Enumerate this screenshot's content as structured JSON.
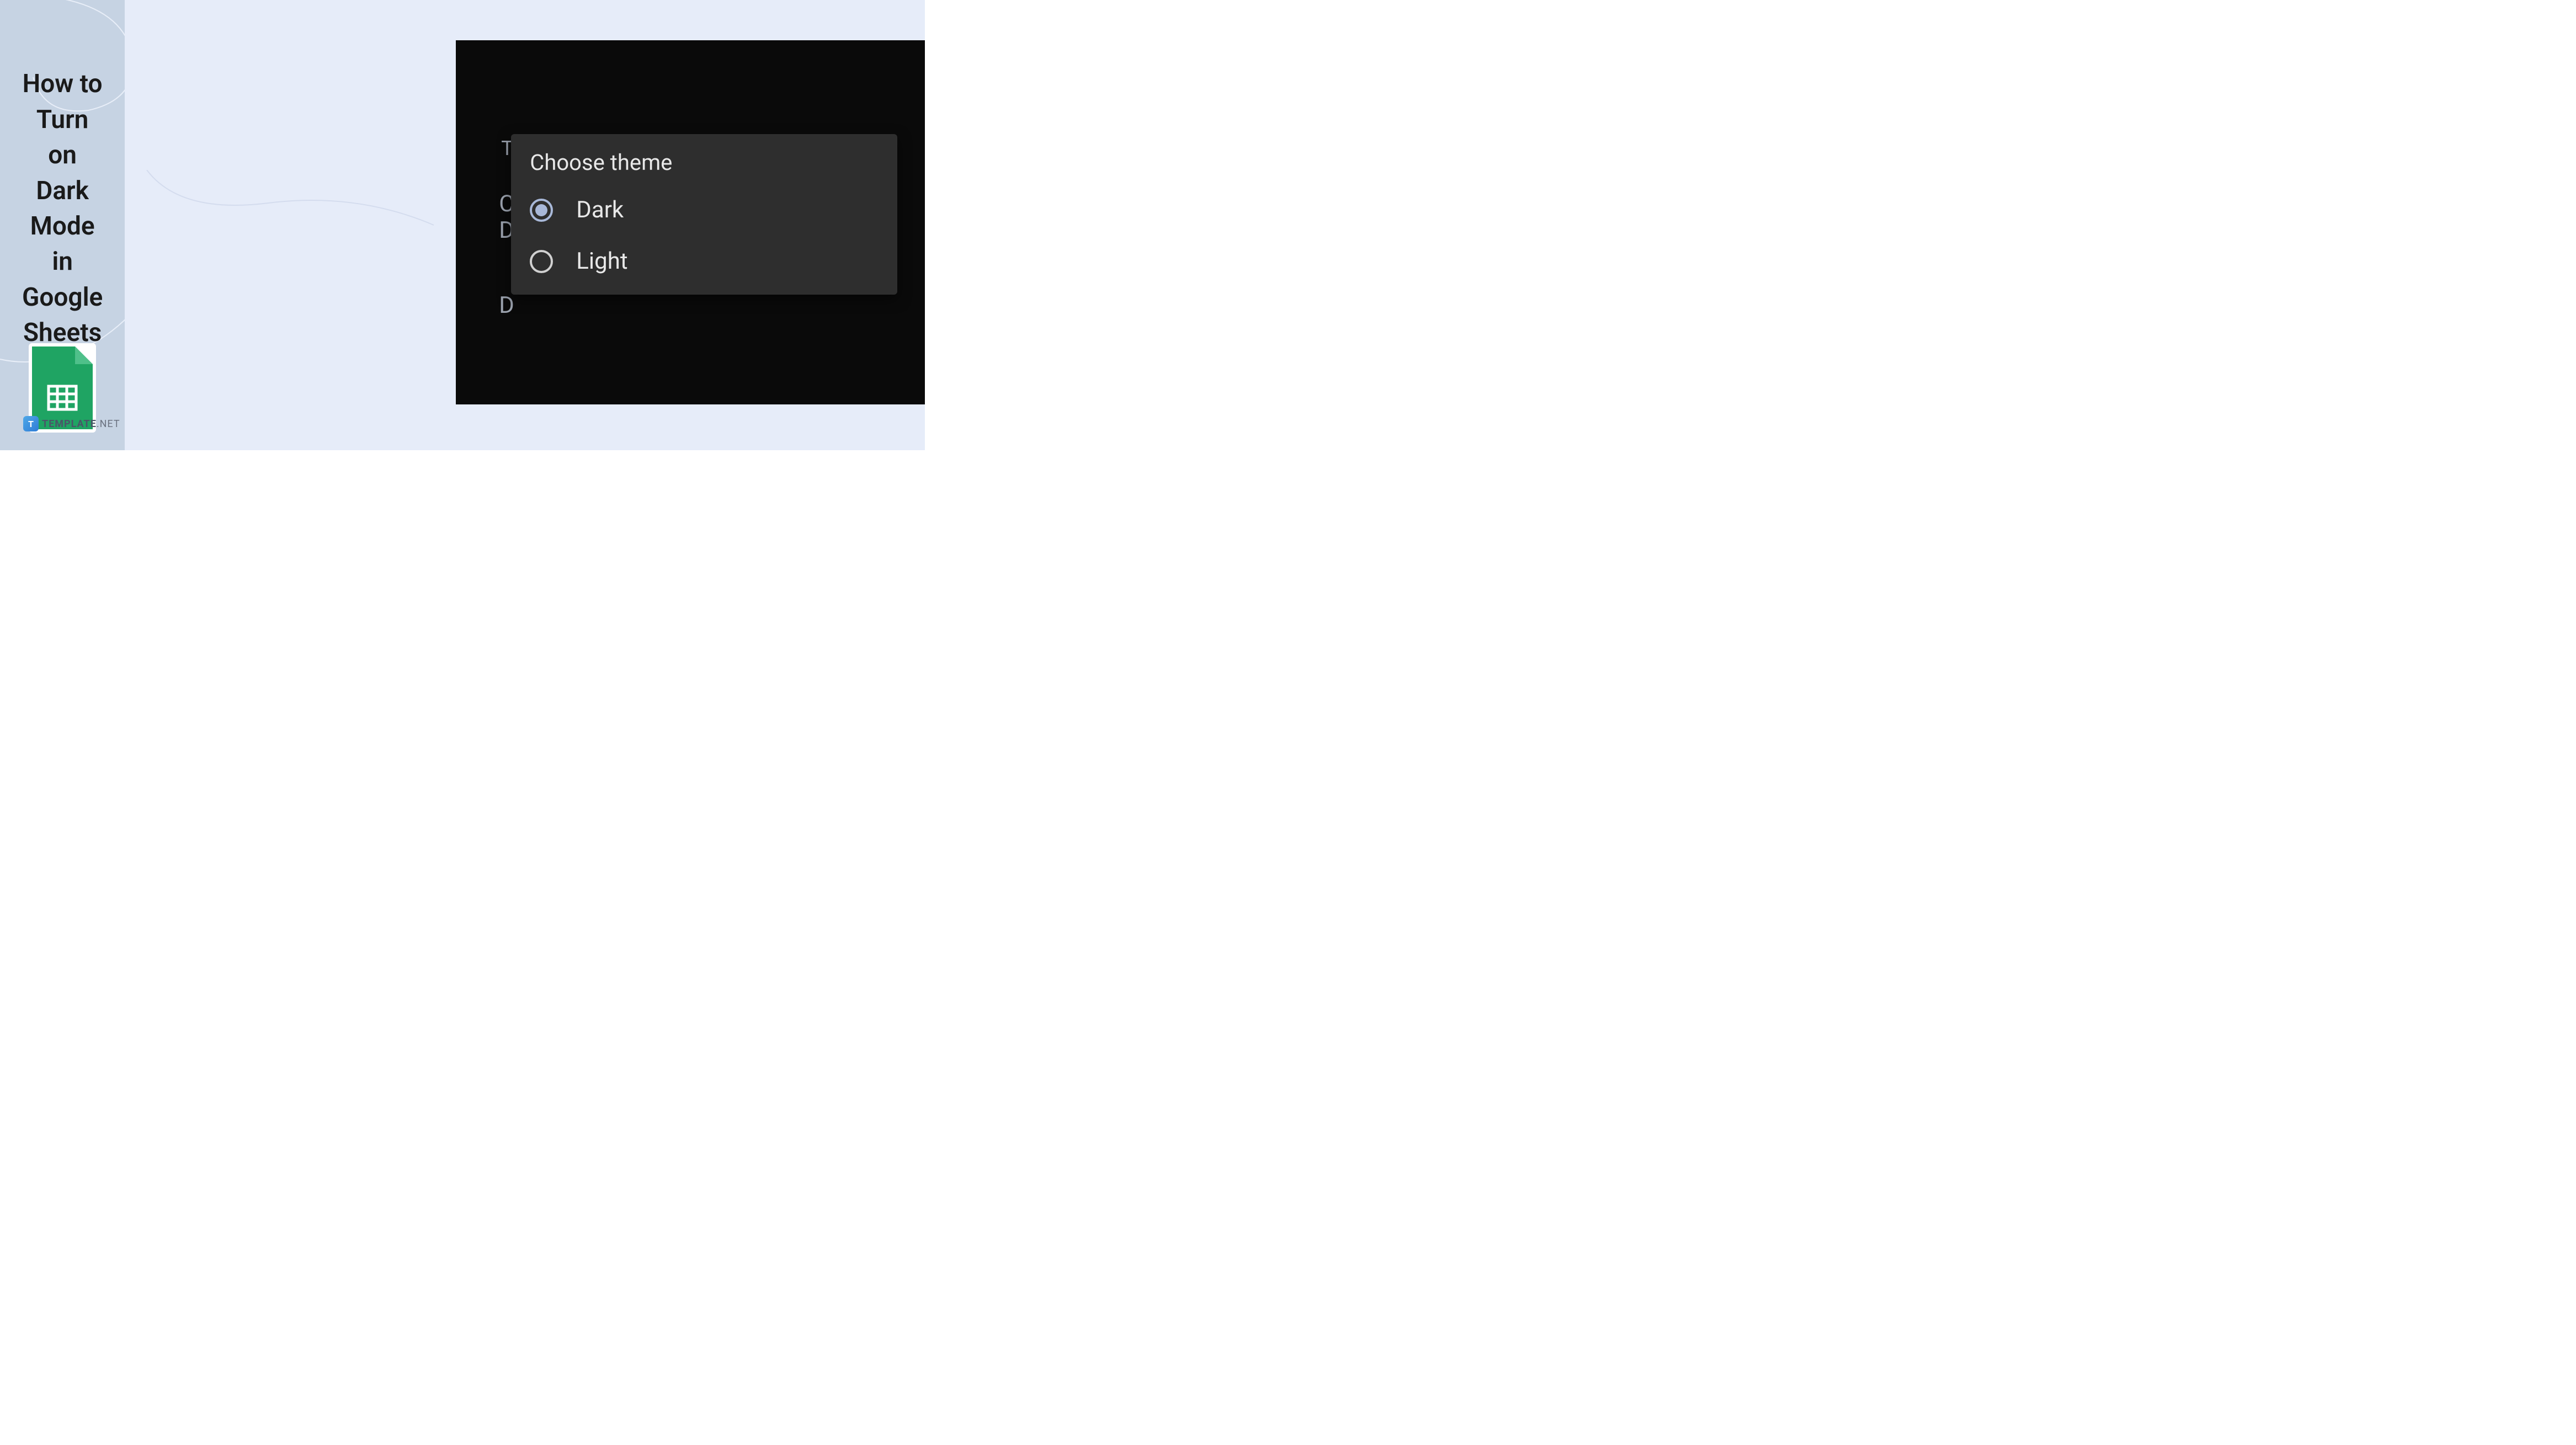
{
  "title": "How to Turn on Dark Mode in Google Sheets",
  "logo": {
    "icon_letter": "T",
    "brand": "TEMPLATE",
    "suffix": ".NET"
  },
  "dialog": {
    "bg_theme_label": "T",
    "bg_letters": {
      "c": "C",
      "d1": "D",
      "d2": "D"
    },
    "title": "Choose theme",
    "options": [
      {
        "label": "Dark",
        "selected": true
      },
      {
        "label": "Light",
        "selected": false
      }
    ]
  }
}
